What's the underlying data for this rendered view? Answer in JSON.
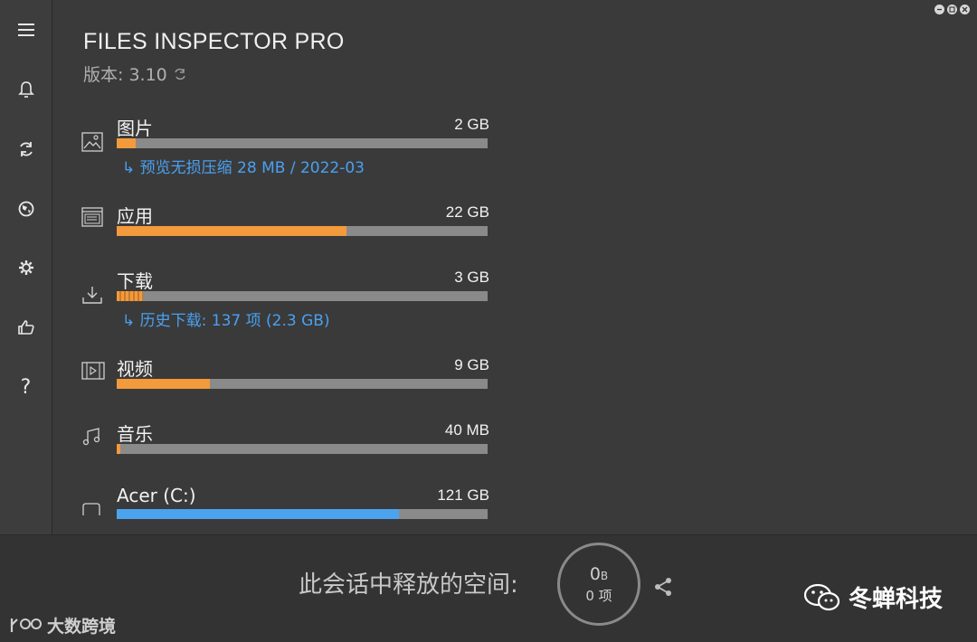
{
  "app": {
    "title": "FILES INSPECTOR PRO",
    "version_label": "版本: 3.10"
  },
  "sidebar": {
    "items": [
      {
        "name": "menu-icon"
      },
      {
        "name": "bell-icon"
      },
      {
        "name": "refresh-icon"
      },
      {
        "name": "globe-icon"
      },
      {
        "name": "gear-icon"
      },
      {
        "name": "thumbs-up-icon"
      },
      {
        "name": "help-icon",
        "label": "?"
      }
    ]
  },
  "categories": [
    {
      "name": "图片",
      "size": "2 GB",
      "fill": 0.05,
      "style": "orange",
      "icon": "image-icon",
      "sub": "↳ 预览无损压缩 28 MB / 2022-03"
    },
    {
      "name": "应用",
      "size": "22 GB",
      "fill": 0.62,
      "style": "orange",
      "icon": "apps-icon"
    },
    {
      "name": "下载",
      "size": "3 GB",
      "fill": 0.07,
      "style": "striped",
      "icon": "download-icon",
      "sub": "↳ 历史下载: 137 项 (2.3 GB)"
    },
    {
      "name": "视频",
      "size": "9 GB",
      "fill": 0.25,
      "style": "orange",
      "icon": "video-icon"
    },
    {
      "name": "音乐",
      "size": "40 MB",
      "fill": 0.01,
      "style": "orange",
      "icon": "music-icon"
    },
    {
      "name": "Acer (C:)",
      "size": "121 GB",
      "fill": 0.76,
      "style": "blue",
      "icon": "drive-icon"
    }
  ],
  "footer": {
    "freed_label": "此会话中释放的空间:",
    "freed_value": "0",
    "freed_unit": "B",
    "freed_items": "0 项",
    "brand": "冬蝉科技",
    "watermark": "大数跨境"
  },
  "colors": {
    "accent": "#f39a3c",
    "drive": "#4ba3ee",
    "link": "#4aa0f0"
  }
}
